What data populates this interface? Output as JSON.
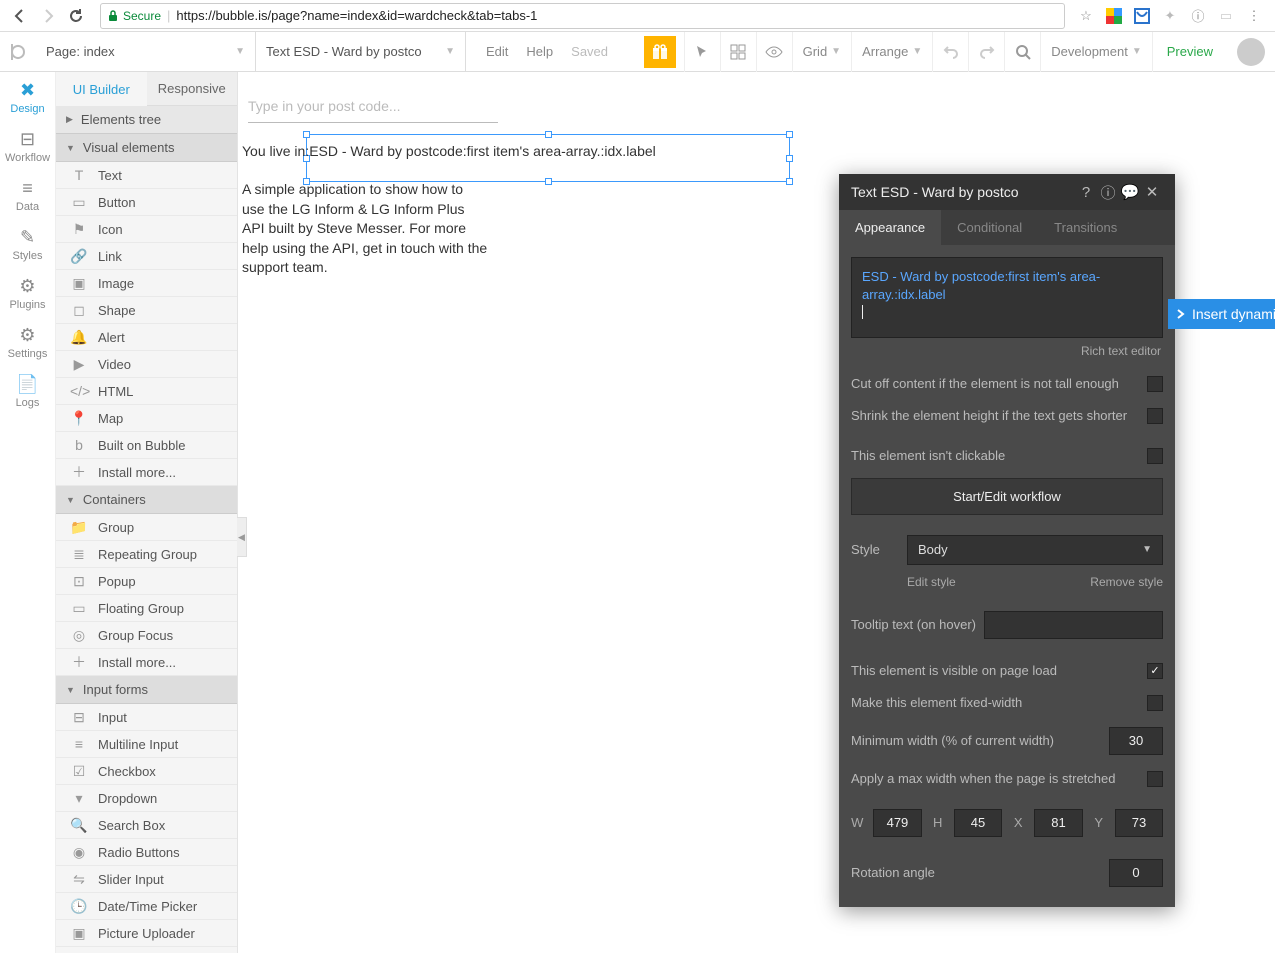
{
  "browser": {
    "secure_label": "Secure",
    "url": "https://bubble.is/page?name=index&id=wardcheck&tab=tabs-1"
  },
  "toolbar": {
    "page_label": "Page: index",
    "element_label": "Text ESD - Ward by postco",
    "edit": "Edit",
    "help": "Help",
    "saved": "Saved",
    "grid": "Grid",
    "arrange": "Arrange",
    "development": "Development",
    "preview": "Preview"
  },
  "rail": [
    {
      "label": "Design",
      "active": true
    },
    {
      "label": "Workflow"
    },
    {
      "label": "Data"
    },
    {
      "label": "Styles"
    },
    {
      "label": "Plugins"
    },
    {
      "label": "Settings"
    },
    {
      "label": "Logs"
    }
  ],
  "panel": {
    "tabs": {
      "builder": "UI Builder",
      "responsive": "Responsive"
    },
    "tree_header": "Elements tree",
    "groups": {
      "visual": "Visual elements",
      "containers": "Containers",
      "inputs": "Input forms"
    },
    "visual_items": [
      "Text",
      "Button",
      "Icon",
      "Link",
      "Image",
      "Shape",
      "Alert",
      "Video",
      "HTML",
      "Map",
      "Built on Bubble",
      "Install more..."
    ],
    "container_items": [
      "Group",
      "Repeating Group",
      "Popup",
      "Floating Group",
      "Group Focus",
      "Install more..."
    ],
    "input_items": [
      "Input",
      "Multiline Input",
      "Checkbox",
      "Dropdown",
      "Search Box",
      "Radio Buttons",
      "Slider Input",
      "Date/Time Picker",
      "Picture Uploader"
    ]
  },
  "canvas": {
    "input_placeholder": "Type in your post code...",
    "line1_prefix": "You live in:",
    "line1_dyn": "ESD - Ward by postcode:first item's area-array.:idx.label",
    "para": "A simple application to show how to\nuse the LG Inform & LG Inform Plus\nAPI built by Steve Messer. For more\nhelp using the API, get in touch with the\nsupport team."
  },
  "inspector": {
    "title": "Text ESD - Ward by postco",
    "tabs": {
      "appearance": "Appearance",
      "conditional": "Conditional",
      "transitions": "Transitions"
    },
    "dynamic_text": "ESD - Ward by postcode:first item's area-array.:idx.label",
    "rich_text": "Rich text editor",
    "cutoff": "Cut off content if the element is not tall enough",
    "shrink": "Shrink the element height if the text gets shorter",
    "clickable": "This element isn't clickable",
    "workflow_btn": "Start/Edit workflow",
    "style_label": "Style",
    "style_value": "Body",
    "edit_style": "Edit style",
    "remove_style": "Remove style",
    "tooltip_label": "Tooltip text (on hover)",
    "visible": "This element is visible on page load",
    "fixed_width": "Make this element fixed-width",
    "min_width_label": "Minimum width (% of current width)",
    "min_width_value": "30",
    "max_width": "Apply a max width when the page is stretched",
    "dims": {
      "W": "479",
      "H": "45",
      "X": "81",
      "Y": "73"
    },
    "rotation_label": "Rotation angle",
    "rotation_value": "0",
    "insert_dynamic": "Insert dynamic"
  }
}
